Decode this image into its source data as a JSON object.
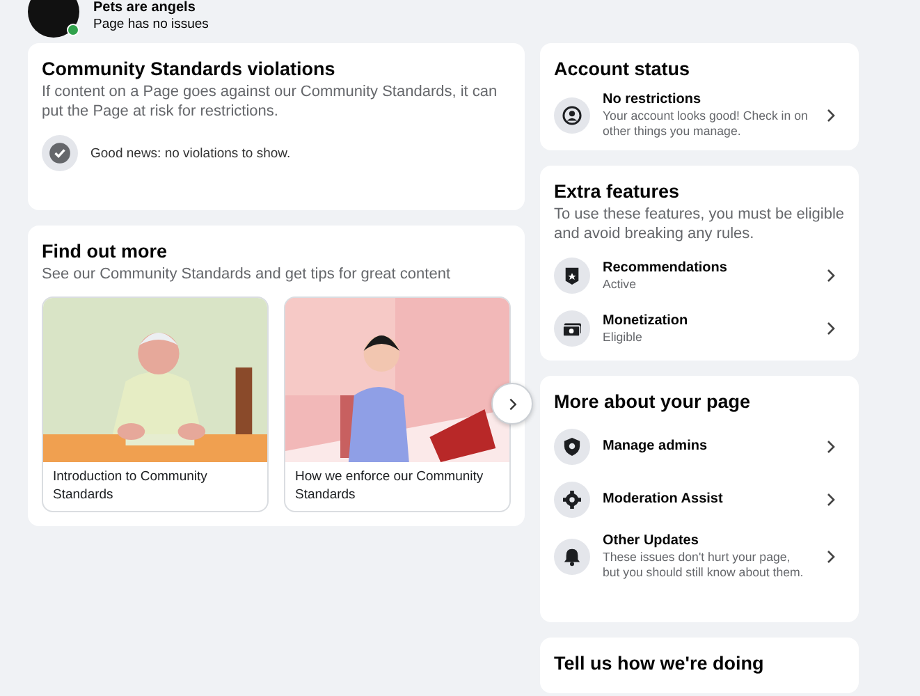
{
  "header": {
    "page_name": "Pets are angels",
    "status": "Page has no issues",
    "online": true
  },
  "violations": {
    "title": "Community Standards violations",
    "description": "If content on a Page goes against our Community Standards, it can put the Page at risk for restrictions.",
    "result": "Good news: no violations to show."
  },
  "find_out_more": {
    "title": "Find out more",
    "subtitle": "See our Community Standards and get tips for great content",
    "articles": [
      {
        "kind": "picture",
        "caption": "Introduction to Community Standards"
      },
      {
        "kind": "picture",
        "caption": "How we enforce our Community Standards"
      }
    ]
  },
  "account_status": {
    "title": "Account status",
    "items": [
      {
        "title": "No restrictions",
        "subtitle": "Your account looks good! Check in on other things you manage."
      }
    ]
  },
  "extra_features": {
    "title": "Extra features",
    "description": "To use these features, you must be eligible and avoid breaking any rules.",
    "items": [
      {
        "title": "Recommendations",
        "subtitle": "Active"
      },
      {
        "title": "Monetization",
        "subtitle": "Eligible"
      }
    ]
  },
  "more_about": {
    "title": "More about your page",
    "items": [
      {
        "title": "Manage admins"
      },
      {
        "title": "Moderation Assist"
      },
      {
        "title": "Other Updates",
        "subtitle": "These issues don't hurt your page, but you should still know about them."
      }
    ]
  },
  "feedback": {
    "title": "Tell us how we're doing"
  }
}
